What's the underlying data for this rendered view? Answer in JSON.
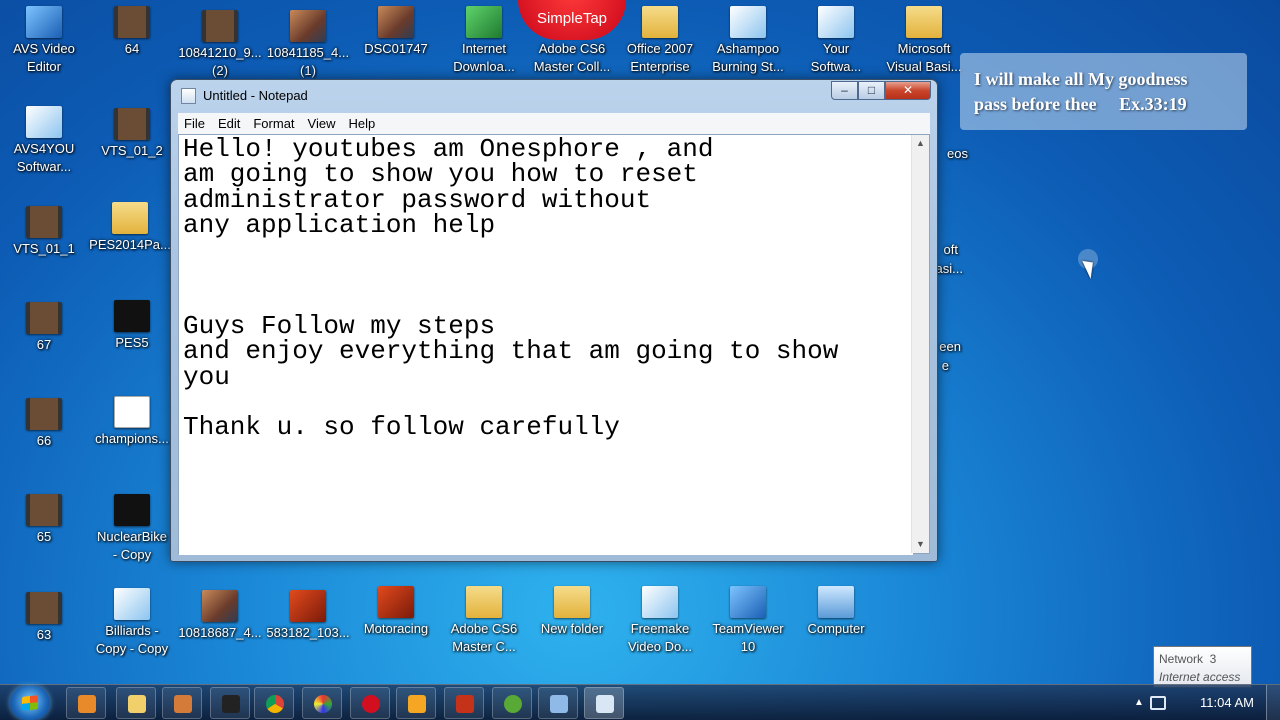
{
  "desktop": {
    "icons": [
      {
        "label": "AVS Video\nEditor"
      },
      {
        "label": "64"
      },
      {
        "label": "10841210_9...\n(2)"
      },
      {
        "label": "10841185_4...\n(1)"
      },
      {
        "label": "DSC01747"
      },
      {
        "label": "Internet\nDownloa..."
      },
      {
        "label": "Adobe CS6\nMaster Coll..."
      },
      {
        "label": "Office 2007\nEnterprise"
      },
      {
        "label": "Ashampoo\nBurning St..."
      },
      {
        "label": "Your\nSoftwa..."
      },
      {
        "label": "Microsoft\nVisual Basi..."
      },
      {
        "label": "AVS4YOU\nSoftwar..."
      },
      {
        "label": "VTS_01_2"
      },
      {
        "label": "VTS_01_1"
      },
      {
        "label": "PES2014Pa..."
      },
      {
        "label": "67"
      },
      {
        "label": "PES5"
      },
      {
        "label": "66"
      },
      {
        "label": "champions..."
      },
      {
        "label": "65"
      },
      {
        "label": "NuclearBike\n- Copy"
      },
      {
        "label": "63"
      },
      {
        "label": "Billiards -\nCopy - Copy"
      },
      {
        "label": "10818687_4..."
      },
      {
        "label": "583182_103..."
      },
      {
        "label": "Motoracing"
      },
      {
        "label": "Adobe CS6\nMaster C..."
      },
      {
        "label": "New folder"
      },
      {
        "label": "Freemake\nVideo Do..."
      },
      {
        "label": "TeamViewer\n10"
      },
      {
        "label": "Computer"
      }
    ],
    "partial_labels": [
      "eos",
      "oft",
      "asi...",
      "een",
      "e"
    ]
  },
  "simpletap": {
    "label": "SimpleTap"
  },
  "verse": {
    "line1": "I will make all My goodness",
    "line2": "pass before thee     Ex.33:19"
  },
  "notepad": {
    "title": "Untitled - Notepad",
    "menu": [
      "File",
      "Edit",
      "Format",
      "View",
      "Help"
    ],
    "content": "Hello! youtubes am Onesphore , and\nam going to show you how to reset\nadministrator password without\nany application help\n\n\n\nGuys Follow my steps\nand enjoy everything that am going to show\nyou\n\nThank u. so follow carefully",
    "buttons": {
      "minimize": "–",
      "maximize": "□",
      "close": "✕"
    }
  },
  "network_tooltip": {
    "title": "Network  3",
    "status": "Internet access"
  },
  "taskbar": {
    "clock": "11:04 AM",
    "tray_arrow": "▲"
  },
  "colors": {
    "desktop": "#1a86d6",
    "simpletap": "#c9061a",
    "close_button": "#c9462b"
  }
}
